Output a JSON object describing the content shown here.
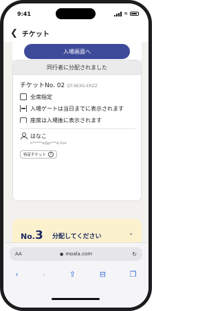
{
  "status": {
    "time": "9:41"
  },
  "nav": {
    "back_icon": "chevron-left-icon",
    "title": "チケット"
  },
  "top_card": {
    "button": "入場画面へ"
  },
  "ticket_card": {
    "header": "同行者に分配されました",
    "ticket_label": "チケットNo. 02",
    "ticket_code": "QT-6EXG-ERZZ",
    "rows": [
      {
        "icon": "seat-icon",
        "text": "全席指定"
      },
      {
        "icon": "gate-icon",
        "text": "入場ゲートは当日までに表示されます"
      },
      {
        "icon": "chair-icon",
        "text": "座席は入場後に表示されます"
      }
    ],
    "user": {
      "name": "はなこ",
      "email": "h*****a@p***d.live"
    },
    "badge": "特定チケット",
    "badge_icon": "?"
  },
  "distribute_card": {
    "prefix": "No.",
    "number": "3",
    "text": "分配してください",
    "chevron": "chevron-down-icon"
  },
  "browser": {
    "aa": "AA",
    "url": "moala.com"
  }
}
